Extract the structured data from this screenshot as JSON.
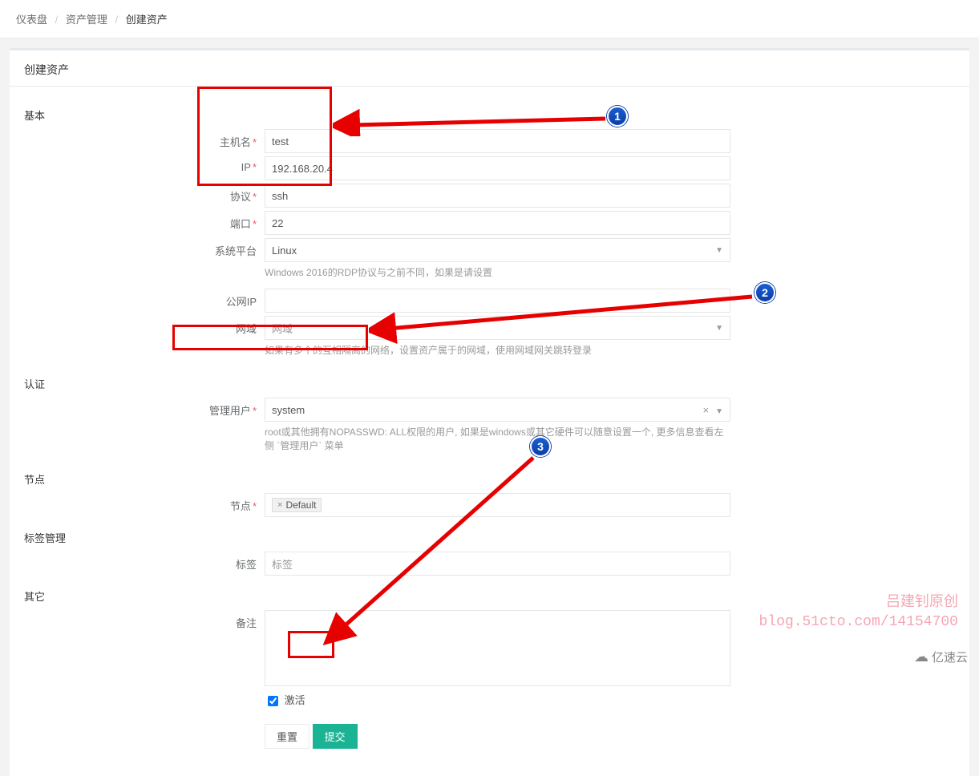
{
  "breadcrumb": {
    "a": "仪表盘",
    "b": "资产管理",
    "c": "创建资产"
  },
  "panel_title": "创建资产",
  "sections": {
    "basic": "基本",
    "auth": "认证",
    "node": "节点",
    "tagmgmt": "标签管理",
    "other": "其它"
  },
  "labels": {
    "hostname": "主机名",
    "ip": "IP",
    "protocol": "协议",
    "port": "端口",
    "platform": "系统平台",
    "public_ip": "公网IP",
    "domain": "网域",
    "admin_user": "管理用户",
    "node": "节点",
    "tags": "标签",
    "notes": "备注",
    "active": "激活"
  },
  "values": {
    "hostname": "test",
    "ip": "192.168.20.4",
    "protocol": "ssh",
    "port": "22",
    "platform": "Linux",
    "public_ip": "",
    "domain_placeholder": "网域",
    "admin_user": "system",
    "node_tag": "Default",
    "tags_placeholder": "标签"
  },
  "help": {
    "platform": "Windows 2016的RDP协议与之前不同，如果是请设置",
    "domain": "如果有多个的互相隔离的网络，设置资产属于的网域，使用网域网关跳转登录",
    "admin_user": "root或其他拥有NOPASSWD: ALL权限的用户, 如果是windows或其它硬件可以随意设置一个, 更多信息查看左侧 `管理用户` 菜单"
  },
  "buttons": {
    "reset": "重置",
    "submit": "提交"
  },
  "annotations": {
    "n1": "1",
    "n2": "2",
    "n3": "3"
  },
  "watermark": {
    "line1": "吕建钊原创",
    "line2": "blog.51cto.com/14154700",
    "logo": "亿速云"
  }
}
